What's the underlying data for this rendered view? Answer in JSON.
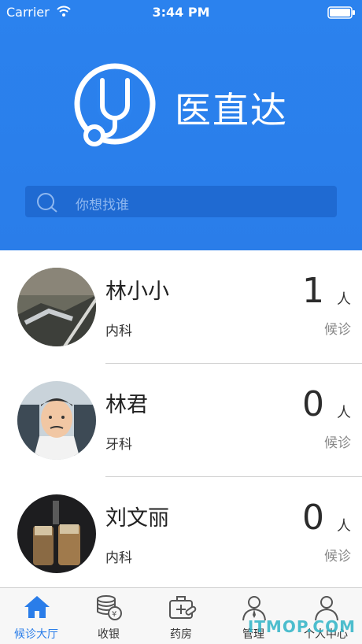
{
  "status_bar": {
    "carrier": "Carrier",
    "time": "3:44 PM"
  },
  "app": {
    "title": "医直达",
    "accent": "#2a7de9"
  },
  "search": {
    "placeholder": "你想找谁"
  },
  "doctors": [
    {
      "name": "林小小",
      "dept": "内科",
      "count": "1",
      "unit": "人",
      "status": "候诊"
    },
    {
      "name": "林君",
      "dept": "牙科",
      "count": "0",
      "unit": "人",
      "status": "候诊"
    },
    {
      "name": "刘文丽",
      "dept": "内科",
      "count": "0",
      "unit": "人",
      "status": "候诊"
    }
  ],
  "tabs": [
    {
      "label": "候诊大厅",
      "icon": "home-icon",
      "active": true
    },
    {
      "label": "收银",
      "icon": "coins-icon"
    },
    {
      "label": "药房",
      "icon": "medkit-icon"
    },
    {
      "label": "管理",
      "icon": "manager-icon"
    },
    {
      "label": "个人中心",
      "icon": "person-icon"
    }
  ],
  "watermark": "ITMOP.COM"
}
